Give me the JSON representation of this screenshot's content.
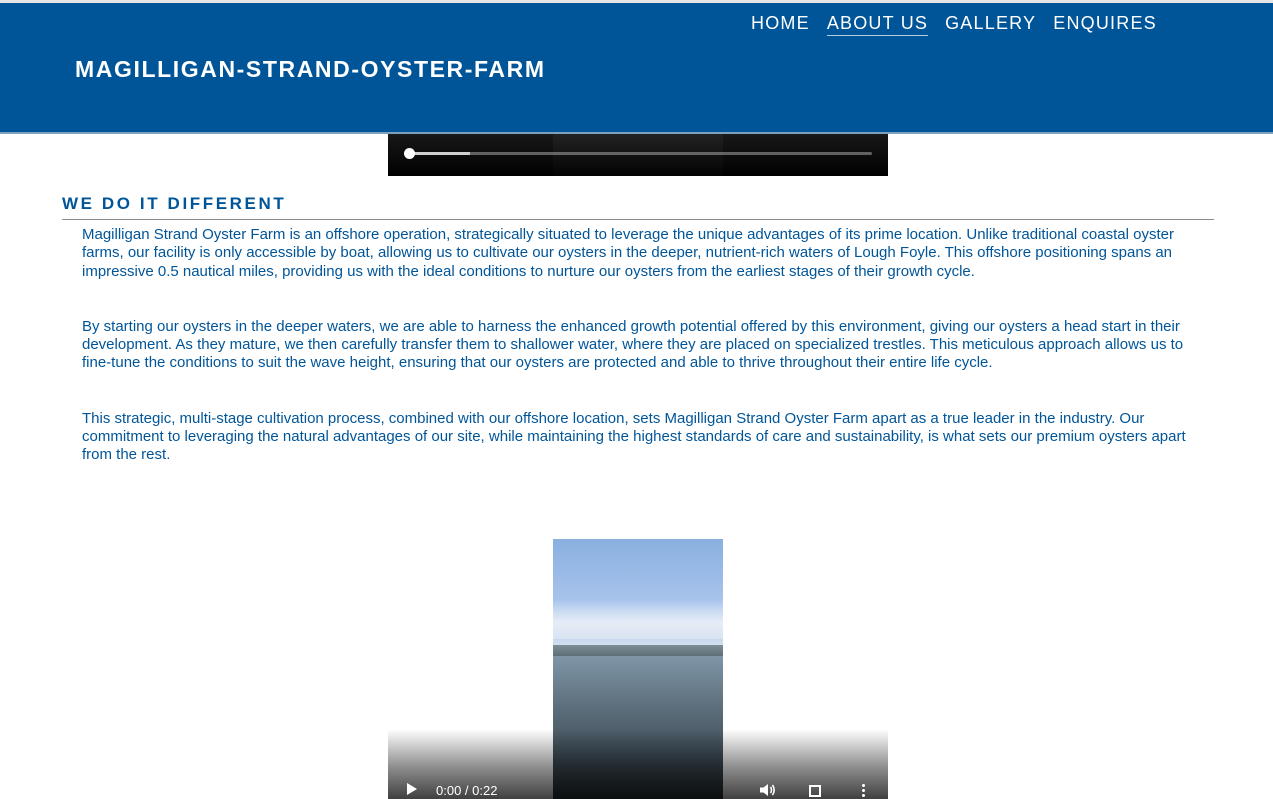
{
  "header": {
    "site_title": "MAGILLIGAN-STRAND-OYSTER-FARM",
    "nav": [
      "HOME",
      "ABOUT US",
      "GALLERY",
      "ENQUIRES"
    ],
    "active_nav": "ABOUT US",
    "background_color": "#005599"
  },
  "top_video": {
    "progress_fraction": 0.0,
    "buffered_fraction": 0.13
  },
  "main": {
    "heading": "WE DO IT DIFFERENT",
    "paragraphs": [
      "Magilligan Strand Oyster Farm is an offshore operation, strategically situated to leverage the unique advantages of its prime location. Unlike traditional coastal oyster farms, our facility is only accessible by boat, allowing us to cultivate our oysters in the deeper, nutrient-rich waters of Lough Foyle. This offshore positioning spans an impressive 0.5 nautical miles, providing us with the ideal conditions to nurture our oysters from the earliest stages of their growth cycle.",
      "By starting our oysters in the deeper waters, we are able to harness the enhanced growth potential offered by this environment, giving our oysters a head start in their development. As they mature, we then carefully transfer them to shallower water, where they are placed on specialized trestles. This meticulous approach allows us to fine-tune the conditions to suit the wave height, ensuring that our oysters are protected and able to thrive throughout their entire life cycle.",
      "This strategic, multi-stage cultivation process, combined with our offshore location, sets Magilligan Strand Oyster Farm apart as a true leader in the industry. Our commitment to leveraging the natural advantages of our site, while maintaining the highest standards of care and sustainability, is what sets our premium oysters apart from the rest."
    ],
    "text_color": "#005599"
  },
  "video": {
    "time": "0:00 / 0:22",
    "icons": [
      "play-icon",
      "volume-icon",
      "fullscreen-icon",
      "more-icon"
    ]
  }
}
